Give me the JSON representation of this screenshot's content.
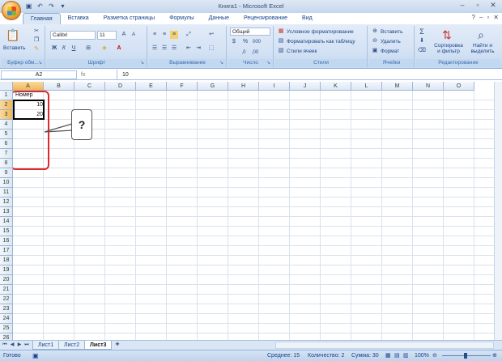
{
  "window": {
    "title": "Книга1 - Microsoft Excel"
  },
  "tabs": [
    "Главная",
    "Вставка",
    "Разметка страницы",
    "Формулы",
    "Данные",
    "Рецензирование",
    "Вид"
  ],
  "ribbon": {
    "clipboard": {
      "paste": "Вставить",
      "label": "Буфер обм..."
    },
    "font": {
      "name": "Calibri",
      "size": "11",
      "bold": "Ж",
      "italic": "К",
      "underline": "Ч",
      "label": "Шрифт"
    },
    "alignment": {
      "label": "Выравнивание"
    },
    "number": {
      "format": "Общий",
      "label": "Число",
      "percent": "%",
      "thousands": "000"
    },
    "styles": {
      "conditional": "Условное форматирование",
      "table": "Форматировать как таблицу",
      "cell_styles": "Стили ячеек",
      "label": "Стили"
    },
    "cells": {
      "insert": "Вставить",
      "delete": "Удалить",
      "format": "Формат",
      "label": "Ячейки"
    },
    "editing": {
      "sort": "Сортировка и фильтр",
      "find": "Найти и выделить",
      "label": "Редактирование",
      "sum": "Σ"
    }
  },
  "formula_bar": {
    "name_box": "A2",
    "fx": "fx",
    "value": "10"
  },
  "columns": [
    "A",
    "B",
    "C",
    "D",
    "E",
    "F",
    "G",
    "H",
    "I",
    "J",
    "K",
    "L",
    "M",
    "N",
    "O"
  ],
  "rows": [
    "1",
    "2",
    "3",
    "4",
    "5",
    "6",
    "7",
    "8",
    "9",
    "10",
    "11",
    "12",
    "13",
    "14",
    "15",
    "16",
    "17",
    "18",
    "19",
    "20",
    "21",
    "22",
    "23",
    "24",
    "25",
    "26"
  ],
  "cells": {
    "A1": "Номер",
    "A2": "10",
    "A3": "20"
  },
  "callout": "?",
  "sheets": [
    "Лист1",
    "Лист2",
    "Лист3"
  ],
  "active_sheet": "Лист3",
  "status": {
    "ready": "Готово",
    "average": "Среднее: 15",
    "count": "Количество: 2",
    "sum": "Сумма: 30",
    "zoom": "100%"
  }
}
